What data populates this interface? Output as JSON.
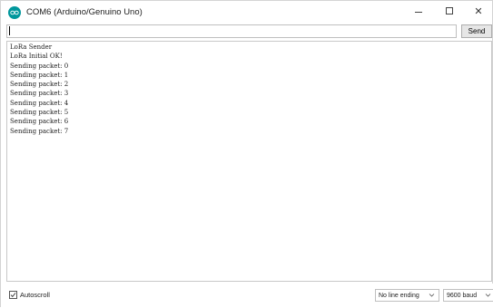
{
  "window": {
    "title": "COM6 (Arduino/Genuino Uno)",
    "minimize_icon": "minimize-icon",
    "maximize_icon": "maximize-icon",
    "close_icon": "close-icon",
    "close_glyph": "✕"
  },
  "input": {
    "value": "",
    "send_label": "Send"
  },
  "output": {
    "lines": [
      "LoRa Sender",
      "LoRa Initial OK!",
      "Sending packet: 0",
      "Sending packet: 1",
      "Sending packet: 2",
      "Sending packet: 3",
      "Sending packet: 4",
      "Sending packet: 5",
      "Sending packet: 6",
      "Sending packet: 7"
    ]
  },
  "footer": {
    "autoscroll_label": "Autoscroll",
    "autoscroll_checked": true,
    "line_ending": "No line ending",
    "baud_rate": "9600 baud"
  },
  "colors": {
    "app_icon": "#00979c"
  }
}
